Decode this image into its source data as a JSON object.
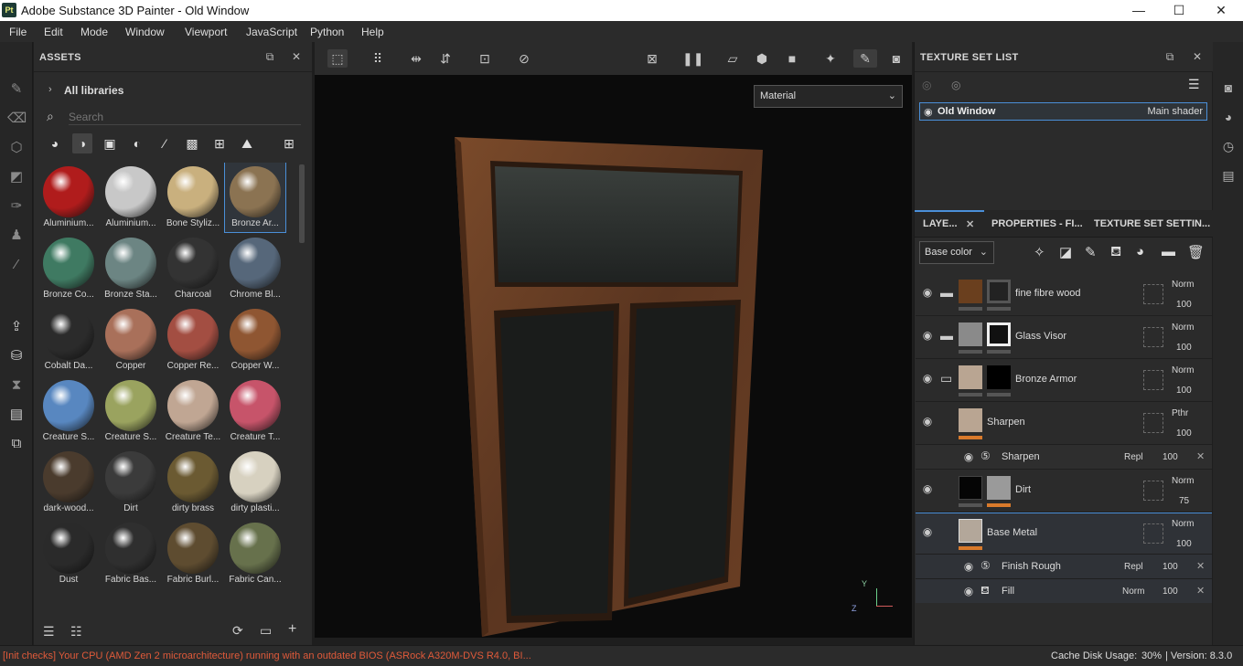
{
  "window": {
    "app_icon": "Pt",
    "title": "Adobe Substance 3D Painter - Old Window",
    "buttons": {
      "minimize": "—",
      "maximize": "☐",
      "close": "✕"
    }
  },
  "menu": [
    "File",
    "Edit",
    "Mode",
    "Window",
    "Viewport",
    "JavaScript",
    "Python",
    "Help"
  ],
  "assets": {
    "title": "ASSETS",
    "breadcrumb": "All libraries",
    "search_placeholder": "Search",
    "materials": [
      {
        "label": "Aluminium...",
        "color": "#b01c1c"
      },
      {
        "label": "Aluminium...",
        "color": "#c8c8c8"
      },
      {
        "label": "Bone Styliz...",
        "color": "#c9b07e"
      },
      {
        "label": "Bronze Ar...",
        "color": "#8b7352"
      },
      {
        "label": "Bronze Co...",
        "color": "#3f7a62"
      },
      {
        "label": "Bronze Sta...",
        "color": "#6c8583"
      },
      {
        "label": "Charcoal",
        "color": "#333333"
      },
      {
        "label": "Chrome Bl...",
        "color": "#56677a"
      },
      {
        "label": "Cobalt Da...",
        "color": "#2b2b2b"
      },
      {
        "label": "Copper",
        "color": "#a9705a"
      },
      {
        "label": "Copper Re...",
        "color": "#a34e42"
      },
      {
        "label": "Copper W...",
        "color": "#8f5632"
      },
      {
        "label": "Creature S...",
        "color": "#5887c0"
      },
      {
        "label": "Creature S...",
        "color": "#9aa35f"
      },
      {
        "label": "Creature Te...",
        "color": "#c0a693"
      },
      {
        "label": "Creature T...",
        "color": "#c7546a"
      },
      {
        "label": "dark-wood...",
        "color": "#4a3b2d"
      },
      {
        "label": "Dirt",
        "color": "#3b3b3b"
      },
      {
        "label": "dirty brass",
        "color": "#6b5a32"
      },
      {
        "label": "dirty plasti...",
        "color": "#d7d1c0"
      },
      {
        "label": "Dust",
        "color": "#2a2a2a"
      },
      {
        "label": "Fabric Bas...",
        "color": "#2f2f2f"
      },
      {
        "label": "Fabric Burl...",
        "color": "#5e4c30"
      },
      {
        "label": "Fabric Can...",
        "color": "#67714c"
      }
    ],
    "selected_material": "Bronze Ar..."
  },
  "viewport": {
    "display_mode": "Material",
    "axis_labels": {
      "y": "Y",
      "z": "Z"
    }
  },
  "texture_set_list": {
    "title": "TEXTURE SET LIST",
    "item": {
      "name": "Old Window",
      "shader": "Main shader"
    }
  },
  "layers_panel": {
    "tabs": [
      "LAYE...",
      "PROPERTIES - FI...",
      "TEXTURE SET SETTIN..."
    ],
    "channel": "Base color",
    "layers": [
      {
        "name": "fine fibre wood",
        "blend": "Norm",
        "opacity": "100",
        "type": "folder"
      },
      {
        "name": "Glass Visor",
        "blend": "Norm",
        "opacity": "100",
        "type": "folder"
      },
      {
        "name": "Bronze Armor",
        "blend": "Norm",
        "opacity": "100",
        "type": "folder-open"
      },
      {
        "name": "Sharpen",
        "blend": "Pthr",
        "opacity": "100",
        "type": "layer"
      },
      {
        "name": "Sharpen",
        "blend": "Repl",
        "opacity": "100",
        "type": "filter"
      },
      {
        "name": "Dirt",
        "blend": "Norm",
        "opacity": "75",
        "type": "layer"
      },
      {
        "name": "Base Metal",
        "blend": "Norm",
        "opacity": "100",
        "type": "layer"
      },
      {
        "name": "Finish Rough",
        "blend": "Repl",
        "opacity": "100",
        "type": "filter"
      },
      {
        "name": "Fill",
        "blend": "Norm",
        "opacity": "100",
        "type": "fill"
      }
    ]
  },
  "status": {
    "message": "[Init checks] Your CPU (AMD Zen 2 microarchitecture) running with an outdated BIOS (ASRock A320M-DVS R4.0, BI...",
    "cache": "Cache Disk Usage:",
    "cache_value": "30%",
    "version": "| Version: 8.3.0"
  },
  "colors": {
    "accent": "#4a8fd8",
    "warning": "#e05a3a",
    "orange_bar": "#d97a2b"
  }
}
